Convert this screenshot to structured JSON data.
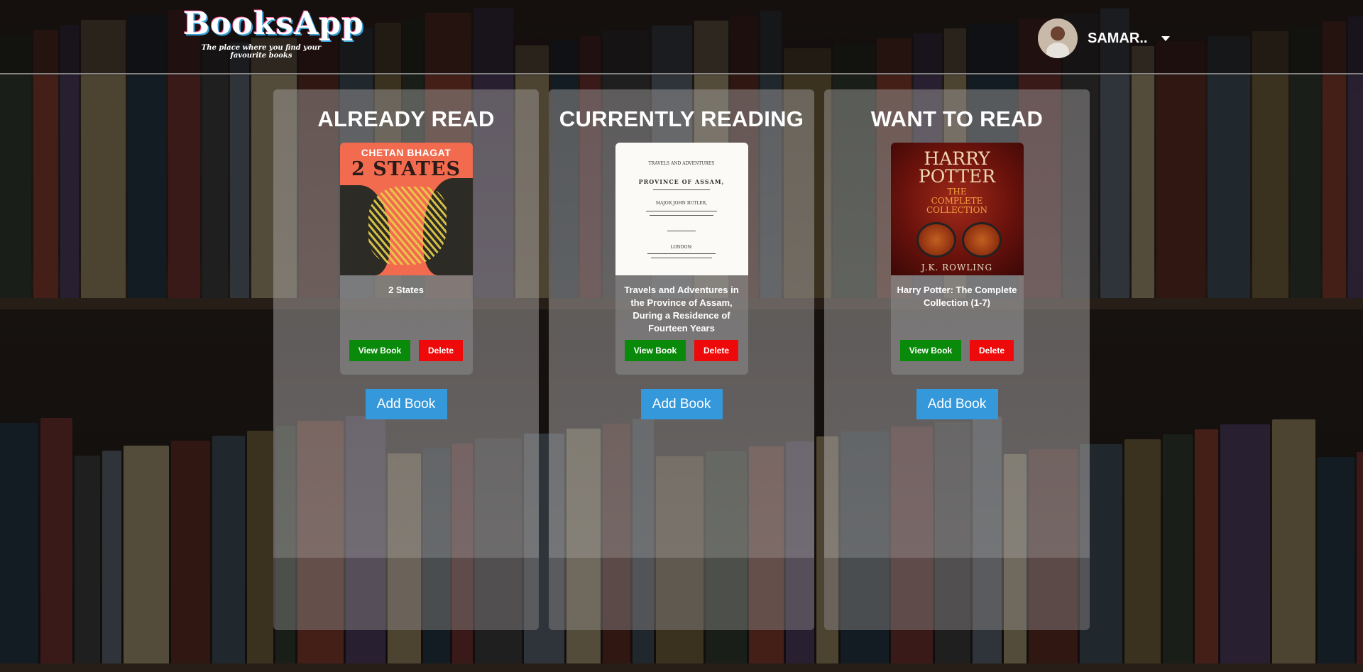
{
  "app": {
    "brand_title": "BooksApp",
    "brand_tagline": "The place where you find your favourite books"
  },
  "user": {
    "name": "SAMAR..",
    "avatar_icon": "user-avatar"
  },
  "columns": [
    {
      "title": "ALREADY READ",
      "book": {
        "title": "2 States",
        "cover_author": "CHETAN BHAGAT",
        "cover_title": "2 STATES",
        "view_label": "View Book",
        "delete_label": "Delete"
      },
      "add_label": "Add Book"
    },
    {
      "title": "CURRENTLY READING",
      "book": {
        "title": "Travels and Adventures in the Province of Assam, During a Residence of Fourteen Years",
        "cover_heading": "TRAVELS AND ADVENTURES",
        "cover_title": "PROVINCE OF ASSAM,",
        "cover_author": "MAJOR JOHN BUTLER,",
        "cover_place": "LONDON:",
        "view_label": "View Book",
        "delete_label": "Delete"
      },
      "add_label": "Add Book"
    },
    {
      "title": "WANT TO READ",
      "book": {
        "title": "Harry Potter: The Complete Collection (1-7)",
        "cover_title_line1": "HARRY",
        "cover_title_line2": "POTTER",
        "cover_sub_line1": "THE",
        "cover_sub_line2": "COMPLETE",
        "cover_sub_line3": "COLLECTION",
        "cover_author": "J.K. ROWLING",
        "view_label": "View Book",
        "delete_label": "Delete"
      },
      "add_label": "Add Book"
    }
  ],
  "colors": {
    "view_button": "#0a8a0a",
    "delete_button": "#ee0a0a",
    "add_button": "#3498db"
  }
}
